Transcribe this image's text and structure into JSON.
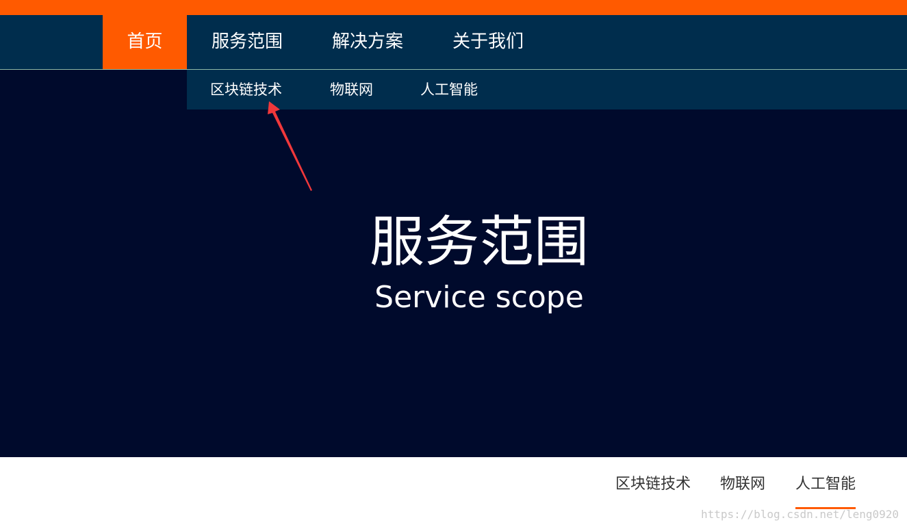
{
  "colors": {
    "accent": "#ff5a00",
    "nav_background": "#002d4d",
    "hero_background": "#000a2c",
    "arrow": "#f0383b"
  },
  "nav": {
    "items": [
      {
        "label": "首页",
        "active": true
      },
      {
        "label": "服务范围",
        "active": false
      },
      {
        "label": "解决方案",
        "active": false
      },
      {
        "label": "关于我们",
        "active": false
      }
    ]
  },
  "subnav": {
    "items": [
      {
        "label": "区块链技术"
      },
      {
        "label": "物联网"
      },
      {
        "label": "人工智能"
      }
    ]
  },
  "hero": {
    "title": "服务范围",
    "subtitle": "Service scope"
  },
  "tabs": {
    "items": [
      {
        "label": "区块链技术",
        "active": false
      },
      {
        "label": "物联网",
        "active": false
      },
      {
        "label": "人工智能",
        "active": true
      }
    ]
  },
  "watermark": "https://blog.csdn.net/leng0920"
}
